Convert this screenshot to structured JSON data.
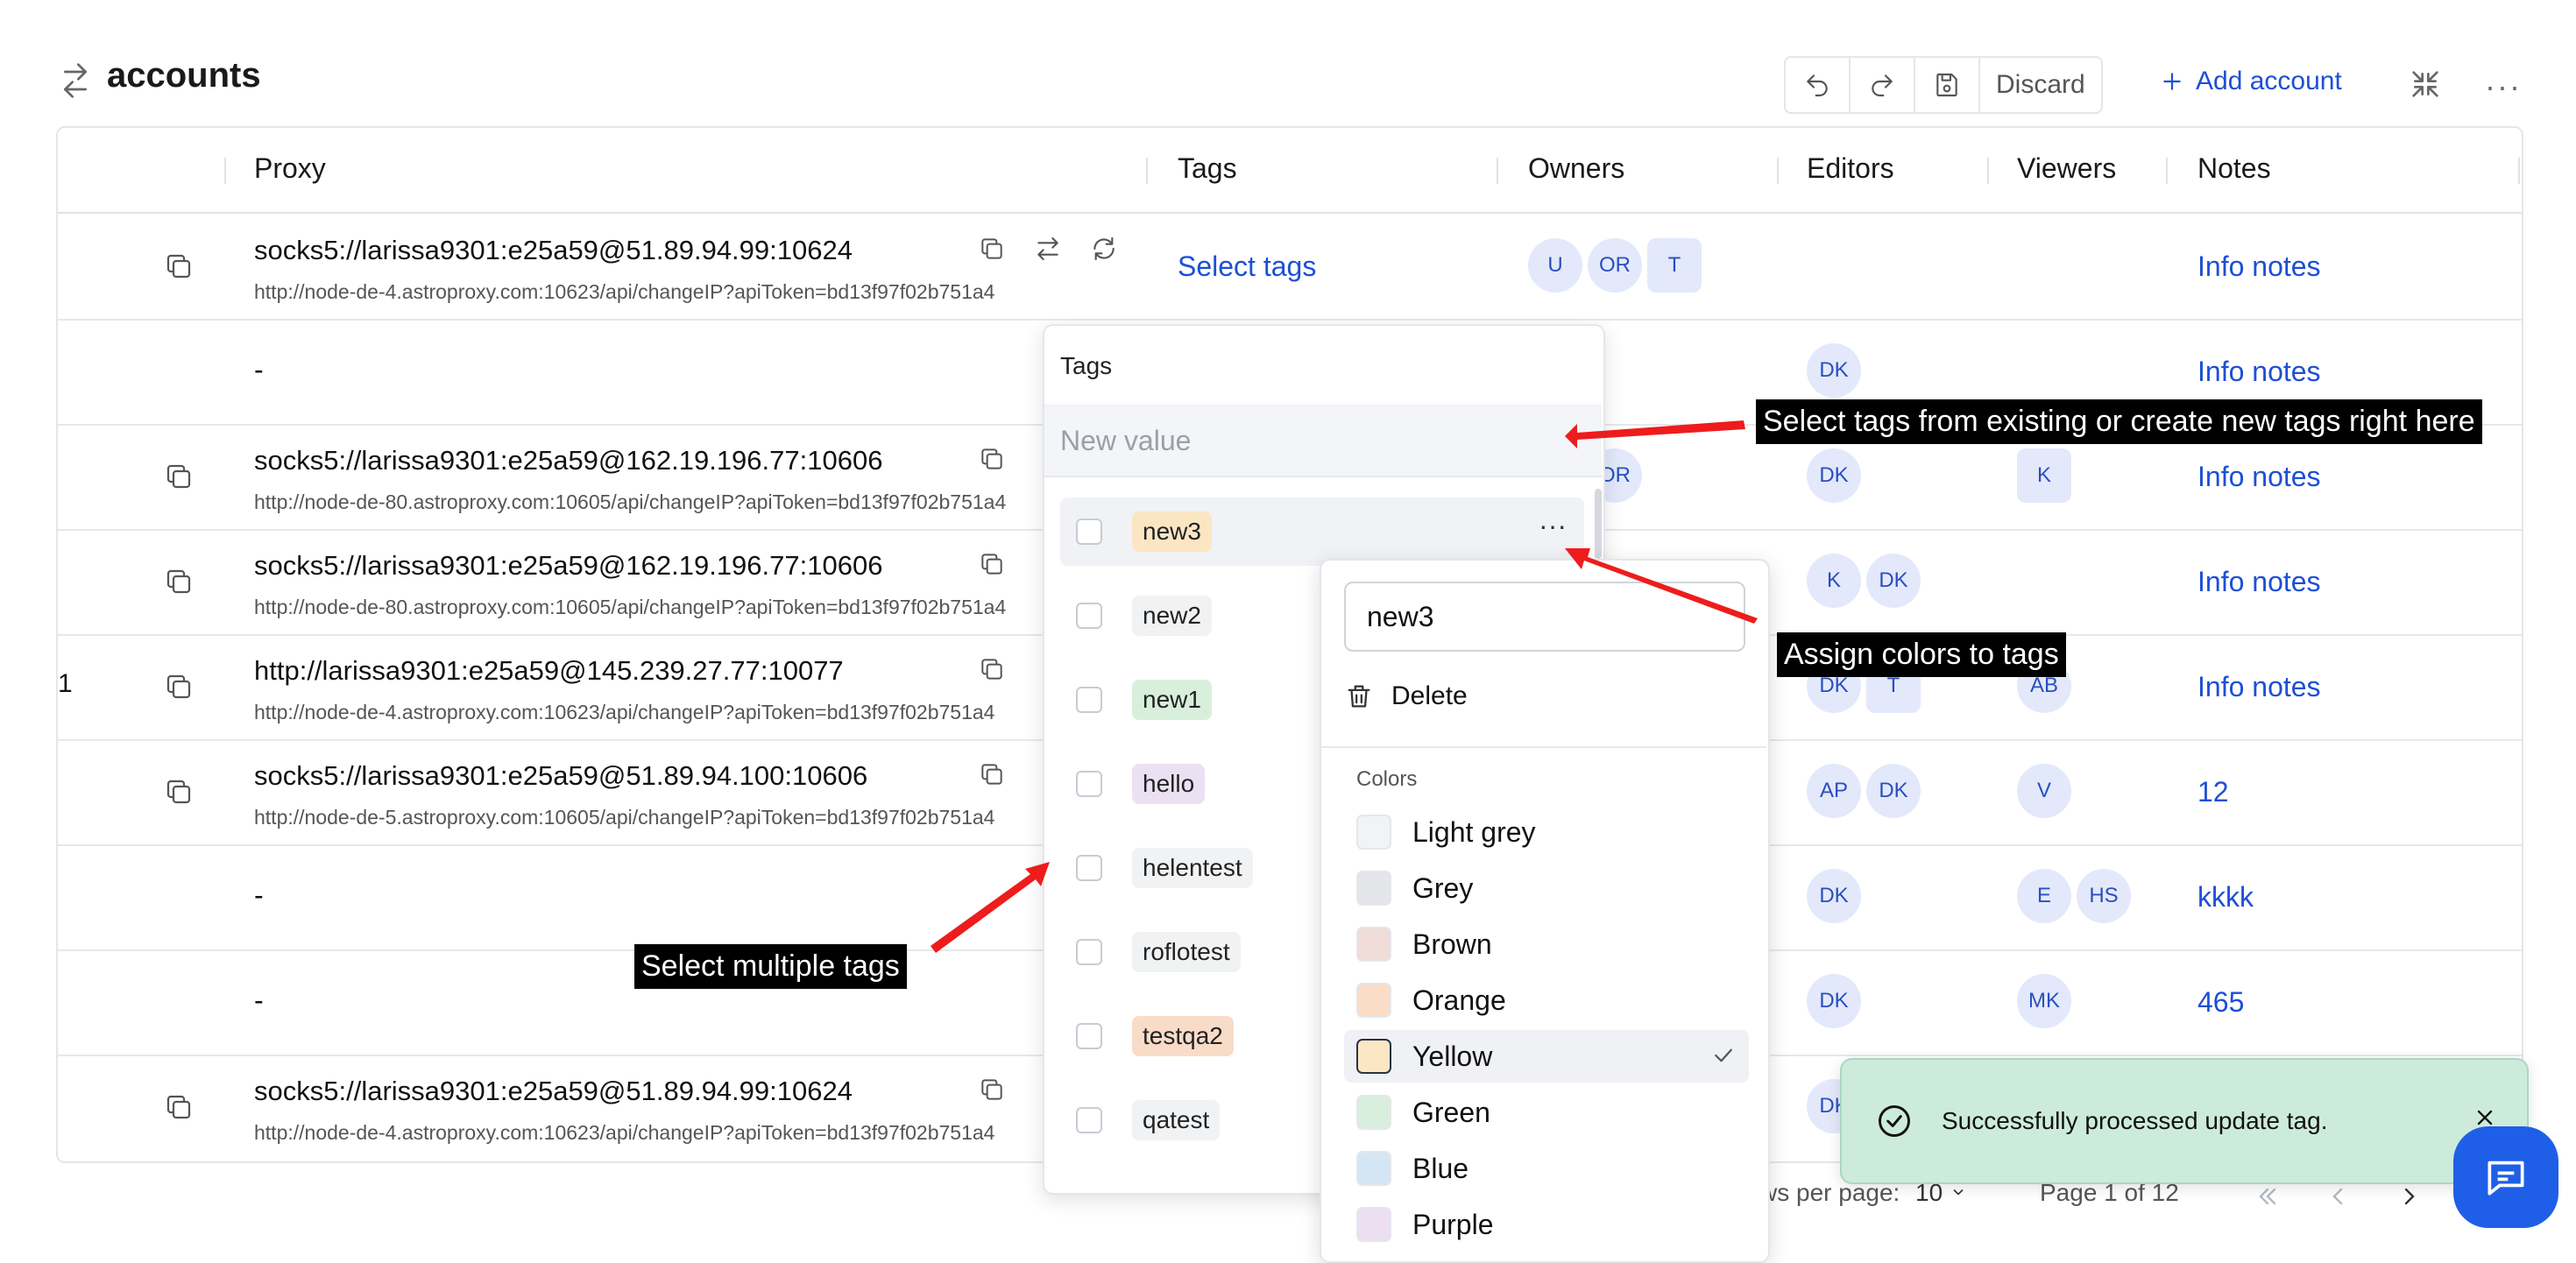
{
  "header": {
    "title": "accounts",
    "discard_label": "Discard",
    "add_account_label": "Add account",
    "more_label": "···"
  },
  "table": {
    "columns": [
      "Proxy",
      "Tags",
      "Owners",
      "Editors",
      "Viewers",
      "Notes"
    ],
    "rows": [
      {
        "num": "",
        "proxy": "socks5://larissa9301:e25a59@51.89.94.99:10624",
        "sub": "http://node-de-4.astroproxy.com:10623/api/changeIP?apiToken=bd13f97f02b751a4",
        "tags": "Select tags",
        "owners": [
          "U",
          "OR",
          "T"
        ],
        "editors": [],
        "viewers": [],
        "note": "Info notes"
      },
      {
        "num": "",
        "proxy": "-",
        "sub": "",
        "tags": "",
        "owners": [],
        "editors": [
          "DK"
        ],
        "viewers": [],
        "note": "Info notes"
      },
      {
        "num": "",
        "proxy": "socks5://larissa9301:e25a59@162.19.196.77:10606",
        "sub": "http://node-de-80.astroproxy.com:10605/api/changeIP?apiToken=bd13f97f02b751a4",
        "tags": "",
        "owners": [
          "OR"
        ],
        "editors": [
          "DK"
        ],
        "viewers": [
          "K"
        ],
        "note": "Info notes"
      },
      {
        "num": "",
        "proxy": "socks5://larissa9301:e25a59@162.19.196.77:10606",
        "sub": "http://node-de-80.astroproxy.com:10605/api/changeIP?apiToken=bd13f97f02b751a4",
        "tags": "",
        "owners": [],
        "editors": [
          "K",
          "DK"
        ],
        "viewers": [],
        "note": "Info notes"
      },
      {
        "num": "1",
        "proxy": "http://larissa9301:e25a59@145.239.27.77:10077",
        "sub": "http://node-de-4.astroproxy.com:10623/api/changeIP?apiToken=bd13f97f02b751a4",
        "tags": "",
        "owners": [],
        "editors": [
          "DK",
          "T"
        ],
        "viewers": [
          "AB"
        ],
        "note": "Info notes"
      },
      {
        "num": "",
        "proxy": "socks5://larissa9301:e25a59@51.89.94.100:10606",
        "sub": "http://node-de-5.astroproxy.com:10605/api/changeIP?apiToken=bd13f97f02b751a4",
        "tags": "",
        "owners": [],
        "editors": [
          "AP",
          "DK"
        ],
        "viewers": [
          "V"
        ],
        "note": "12"
      },
      {
        "num": "",
        "proxy": "-",
        "sub": "",
        "tags": "",
        "owners": [],
        "editors": [
          "DK"
        ],
        "viewers": [
          "E",
          "HS"
        ],
        "note": "kkkk"
      },
      {
        "num": "",
        "proxy": "-",
        "sub": "",
        "tags": "",
        "owners": [],
        "editors": [
          "DK"
        ],
        "viewers": [
          "MK"
        ],
        "note": "465"
      },
      {
        "num": "",
        "proxy": "socks5://larissa9301:e25a59@51.89.94.99:10624",
        "sub": "http://node-de-4.astroproxy.com:10623/api/changeIP?apiToken=bd13f97f02b751a4",
        "tags": "",
        "owners": [],
        "editors": [
          "DK"
        ],
        "viewers": [],
        "note": ""
      }
    ]
  },
  "pagination": {
    "rows_per_page_label": "ws per page:",
    "rows_per_page_value": "10",
    "page_label": "Page 1 of 12"
  },
  "tags_popover": {
    "title": "Tags",
    "new_value_placeholder": "New value",
    "items": [
      {
        "label": "new3",
        "color": "#fbe6c3"
      },
      {
        "label": "new2",
        "color": "#f1f2f4"
      },
      {
        "label": "new1",
        "color": "#d8efdc"
      },
      {
        "label": "hello",
        "color": "#ebe1f3"
      },
      {
        "label": "helentest",
        "color": "#f1f2f4"
      },
      {
        "label": "roflotest",
        "color": "#f1f2f4"
      },
      {
        "label": "testqa2",
        "color": "#f8dcc8"
      },
      {
        "label": "qatest",
        "color": "#f1f2f4"
      }
    ]
  },
  "color_popover": {
    "name_value": "new3",
    "delete_label": "Delete",
    "colors_label": "Colors",
    "colors": [
      {
        "name": "Light grey",
        "hex": "#f1f3f6"
      },
      {
        "name": "Grey",
        "hex": "#e3e5e9"
      },
      {
        "name": "Brown",
        "hex": "#f0dcd8"
      },
      {
        "name": "Orange",
        "hex": "#fbdcc6"
      },
      {
        "name": "Yellow",
        "hex": "#fce7c4"
      },
      {
        "name": "Green",
        "hex": "#d9efdd"
      },
      {
        "name": "Blue",
        "hex": "#d4e6f4"
      },
      {
        "name": "Purple",
        "hex": "#ebdff1"
      }
    ],
    "selected": "Yellow"
  },
  "annotations": {
    "tags_hint": "Select tags from existing or create new tags right here",
    "colors_hint": "Assign colors to tags",
    "multi_hint": "Select multiple tags"
  },
  "toast": {
    "message": "Successfully processed update tag."
  },
  "colors": {
    "accent": "#1d4fd6",
    "arrow": "#ee1c1c",
    "toast_bg": "#cdebdb",
    "chat": "#1f5fe8"
  }
}
